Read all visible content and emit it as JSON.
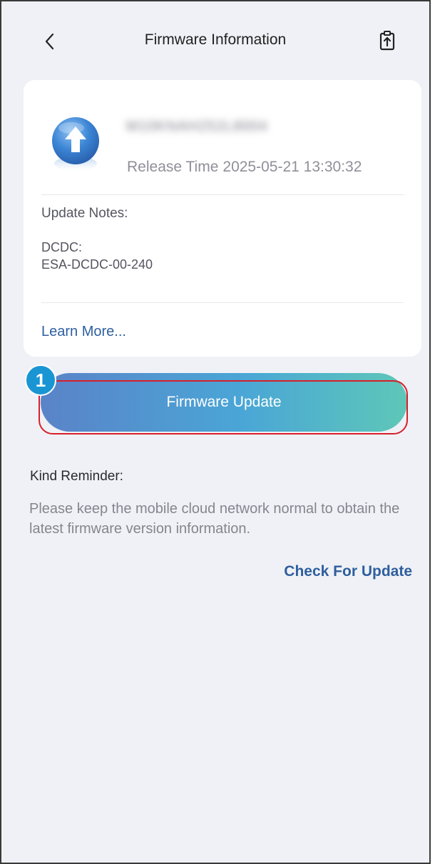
{
  "header": {
    "title": "Firmware Information"
  },
  "firmware": {
    "version": "M10KNAH252L8004",
    "release_label": "Release Time",
    "release_time": "2025-05-21 13:30:32"
  },
  "notes": {
    "title": "Update Notes:",
    "module": "DCDC:",
    "module_version": "ESA-DCDC-00-240",
    "learn_more": "Learn More..."
  },
  "update_button": {
    "label": "Firmware Update",
    "step_number": "1"
  },
  "reminder": {
    "title": "Kind Reminder:",
    "text": "Please keep the mobile cloud network normal to obtain the latest firmware version information."
  },
  "check_update_label": "Check For Update",
  "colors": {
    "accent_link": "#2e5f9e",
    "highlight": "#d6202b",
    "badge": "#1a95d3",
    "button_gradient_start": "#5a83c8",
    "button_gradient_end": "#5ec7b8",
    "background": "#f0f1f6"
  },
  "icons": {
    "back": "chevron-left-icon",
    "export": "export-icon",
    "firmware": "upload-arrow-icon"
  }
}
